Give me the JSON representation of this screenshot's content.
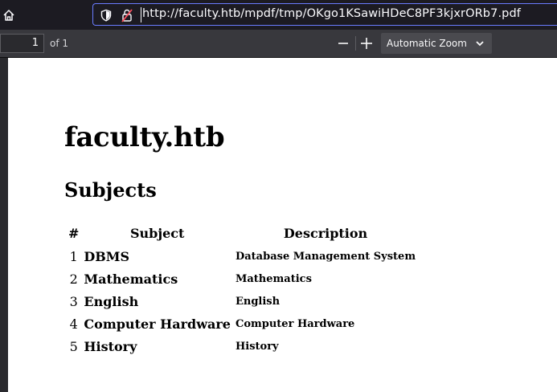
{
  "browser": {
    "url": "http://faculty.htb/mpdf/tmp/OKgo1KSawiHDeC8PF3kjxrORb7.pdf"
  },
  "pdf_toolbar": {
    "page_number": "1",
    "page_count": "of 1",
    "zoom_label": "Automatic Zoom"
  },
  "document": {
    "title": "faculty.htb",
    "heading": "Subjects",
    "table": {
      "headers": [
        "#",
        "Subject",
        "Description"
      ],
      "rows": [
        {
          "num": "1",
          "subject": "DBMS",
          "description": "Database Management System"
        },
        {
          "num": "2",
          "subject": "Mathematics",
          "description": "Mathematics"
        },
        {
          "num": "3",
          "subject": "English",
          "description": "English"
        },
        {
          "num": "4",
          "subject": "Computer Hardware",
          "description": "Computer Hardware"
        },
        {
          "num": "5",
          "subject": "History",
          "description": "History"
        }
      ]
    }
  },
  "colors": {
    "url_focus_border": "#6a7cff",
    "toolbar_bg": "#38383d",
    "viewer_bg": "#2a2a2e",
    "page_bg": "#ffffff"
  },
  "icons": [
    "home-icon",
    "shield-icon",
    "lock-icon",
    "zoom-out-icon",
    "zoom-in-icon",
    "chevron-down-icon"
  ]
}
